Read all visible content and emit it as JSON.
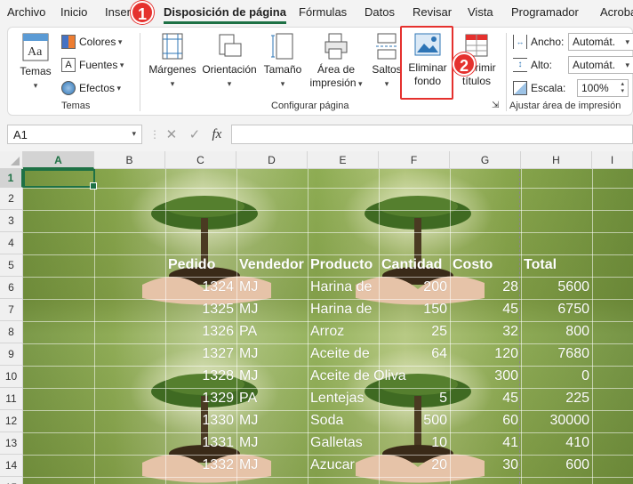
{
  "tabs": [
    "Archivo",
    "Inicio",
    "Inser",
    "Disposición de página",
    "Fórmulas",
    "Datos",
    "Revisar",
    "Vista",
    "Programador",
    "Acroba"
  ],
  "active_tab": "Disposición de página",
  "callouts": {
    "one": "1",
    "two": "2"
  },
  "ribbon": {
    "temas": {
      "label": "Temas",
      "colores": "Colores",
      "fuentes": "Fuentes",
      "efectos": "Efectos",
      "group": "Temas"
    },
    "configurar": {
      "margenes": "Márgenes",
      "orientacion": "Orientación",
      "tamano": "Tamaño",
      "area_line1": "Área de",
      "area_line2": "impresión",
      "saltos": "Saltos",
      "eliminar_line1": "Eliminar",
      "eliminar_line2": "fondo",
      "imprimir_line1": "Imprimir",
      "imprimir_line2": "títulos",
      "group": "Configurar página"
    },
    "ajustar": {
      "ancho_label": "Ancho:",
      "ancho_value": "Automát.",
      "alto_label": "Alto:",
      "alto_value": "Automát.",
      "escala_label": "Escala:",
      "escala_value": "100%",
      "group": "Ajustar área de impresión"
    }
  },
  "formula_bar": {
    "name_box": "A1",
    "fx": "fx",
    "formula": ""
  },
  "columns": [
    "A",
    "B",
    "C",
    "D",
    "E",
    "F",
    "G",
    "H",
    "I"
  ],
  "rows": [
    "1",
    "2",
    "3",
    "4",
    "5",
    "6",
    "7",
    "8",
    "9",
    "10",
    "11",
    "12",
    "13",
    "14",
    "15"
  ],
  "table": {
    "headers": [
      "Pedido",
      "Vendedor",
      "Producto",
      "Cantidad",
      "Costo",
      "Total"
    ],
    "rows": [
      [
        "1324",
        "MJ",
        "Harina de",
        "200",
        "28",
        "5600"
      ],
      [
        "1325",
        "MJ",
        "Harina de",
        "150",
        "45",
        "6750"
      ],
      [
        "1326",
        "PA",
        "Arroz",
        "25",
        "32",
        "800"
      ],
      [
        "1327",
        "MJ",
        "Aceite de",
        "64",
        "120",
        "7680"
      ],
      [
        "1328",
        "MJ",
        "Aceite de Oliva",
        "",
        "300",
        "0"
      ],
      [
        "1329",
        "PA",
        "Lentejas",
        "5",
        "45",
        "225"
      ],
      [
        "1330",
        "MJ",
        "Soda",
        "500",
        "60",
        "30000"
      ],
      [
        "1331",
        "MJ",
        "Galletas",
        "10",
        "41",
        "410"
      ],
      [
        "1332",
        "MJ",
        "Azucar",
        "20",
        "30",
        "600"
      ]
    ]
  }
}
